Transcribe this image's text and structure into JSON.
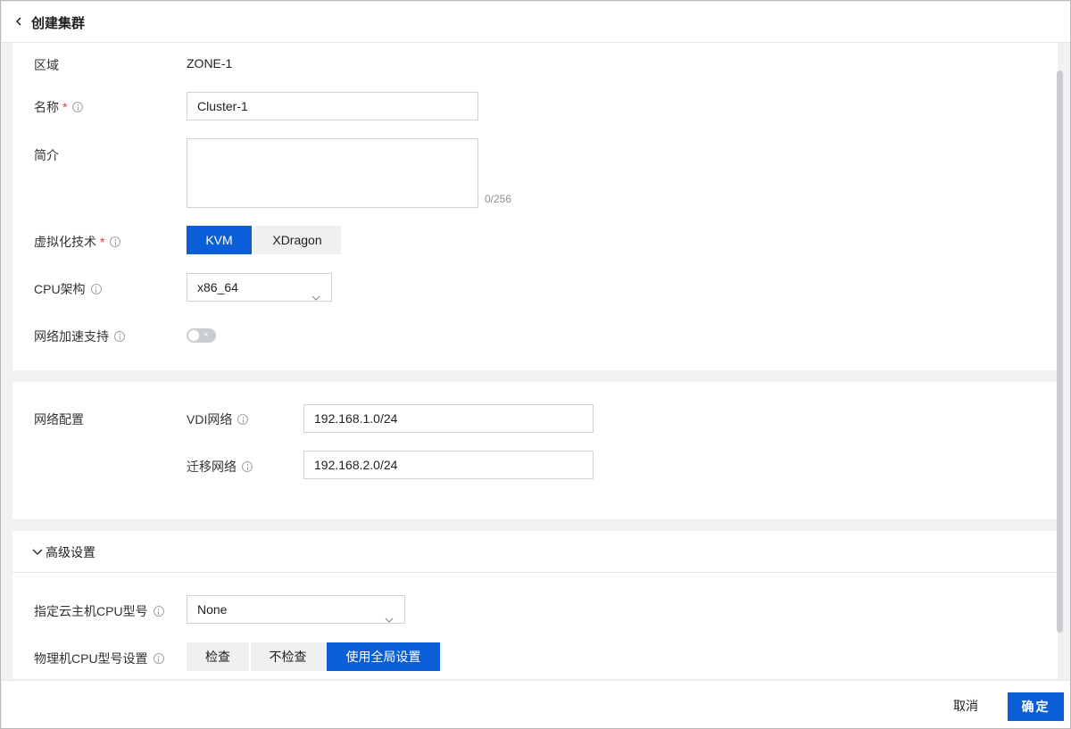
{
  "header": {
    "title": "创建集群",
    "back_icon": "chevron-left-icon"
  },
  "basic": {
    "zone_label": "区域",
    "zone_value": "ZONE-1",
    "name_label": "名称",
    "name_required": "*",
    "name_value": "Cluster-1",
    "desc_label": "简介",
    "desc_value": "",
    "desc_counter": "0/256",
    "virt_label": "虚拟化技术",
    "virt_required": "*",
    "virt_options": [
      "KVM",
      "XDragon"
    ],
    "virt_selected": "KVM",
    "cpu_arch_label": "CPU架构",
    "cpu_arch_value": "x86_64",
    "net_accel_label": "网络加速支持",
    "net_accel_enabled": false,
    "net_accel_off_glyph": "×"
  },
  "network": {
    "section_label": "网络配置",
    "vdi_label": "VDI网络",
    "vdi_value": "192.168.1.0/24",
    "migrate_label": "迁移网络",
    "migrate_value": "192.168.2.0/24"
  },
  "advanced": {
    "title": "高级设置",
    "expanded": true,
    "vm_cpu_model_label": "指定云主机CPU型号",
    "vm_cpu_model_value": "None",
    "host_cpu_label": "物理机CPU型号设置",
    "host_cpu_options": [
      "检查",
      "不检查",
      "使用全局设置"
    ],
    "host_cpu_selected": "使用全局设置"
  },
  "footer": {
    "cancel_label": "取消",
    "ok_label": "确定"
  },
  "colors": {
    "primary": "#0a5fd6",
    "required": "#e53935",
    "toggle_off": "#c9ccd1"
  }
}
